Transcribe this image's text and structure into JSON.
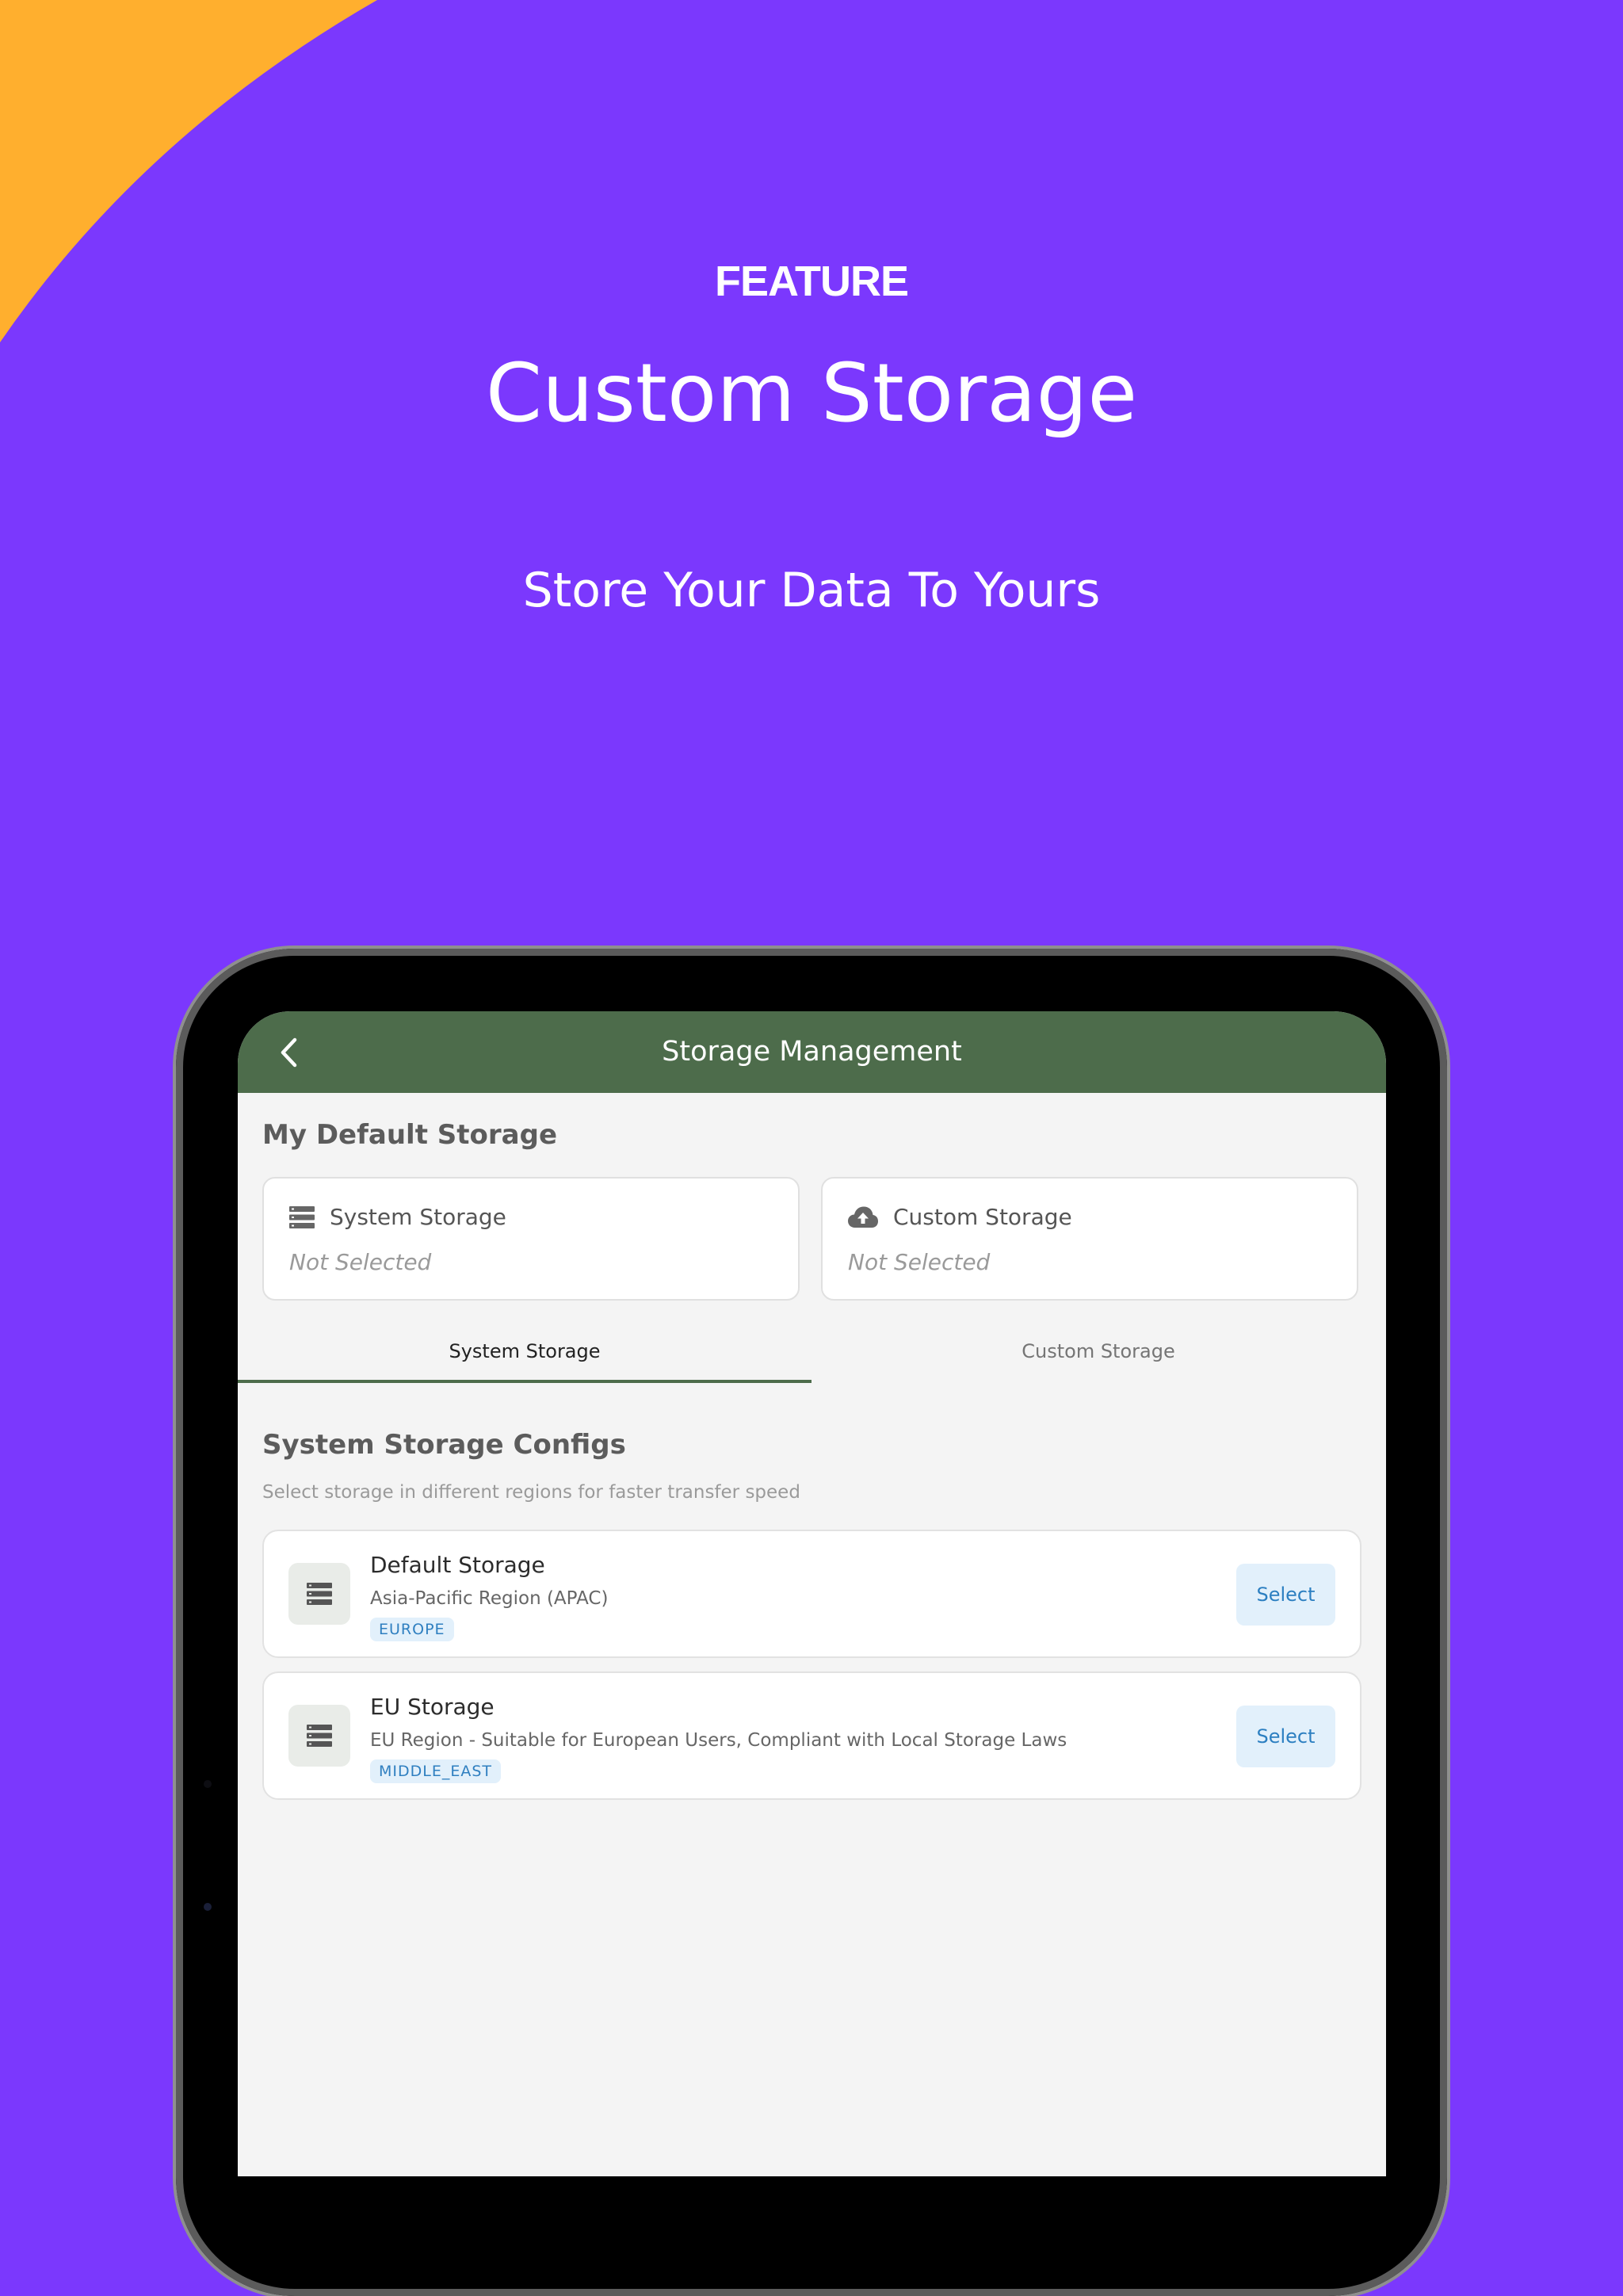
{
  "promo": {
    "kicker": "FEATURE",
    "title": "Custom Storage",
    "subtitle": "Store Your Data To Yours"
  },
  "colors": {
    "background": "#7b38fd",
    "accent_arc": "#ffaf2e",
    "app_bar": "#4d6c4b",
    "select_button_bg": "#e2f0fb",
    "select_button_text": "#2c7fc1"
  },
  "app": {
    "title": "Storage Management",
    "back_icon": "chevron-left-icon"
  },
  "default_storage": {
    "title": "My Default Storage",
    "cards": [
      {
        "label": "System Storage",
        "state": "Not Selected",
        "icon": "server-icon"
      },
      {
        "label": "Custom Storage",
        "state": "Not Selected",
        "icon": "cloud-upload-icon"
      }
    ]
  },
  "tabs": [
    {
      "label": "System Storage",
      "selected": true
    },
    {
      "label": "Custom Storage",
      "selected": false
    }
  ],
  "configs": {
    "title": "System Storage Configs",
    "description": "Select storage in different regions for faster transfer speed",
    "items": [
      {
        "name": "Default Storage",
        "description": "Asia-Pacific Region (APAC)",
        "tag": "EUROPE",
        "action": "Select",
        "icon": "server-icon"
      },
      {
        "name": "EU Storage",
        "description": "EU Region - Suitable for European Users, Compliant with Local Storage Laws",
        "tag": "MIDDLE_EAST",
        "action": "Select",
        "icon": "server-icon"
      }
    ]
  }
}
